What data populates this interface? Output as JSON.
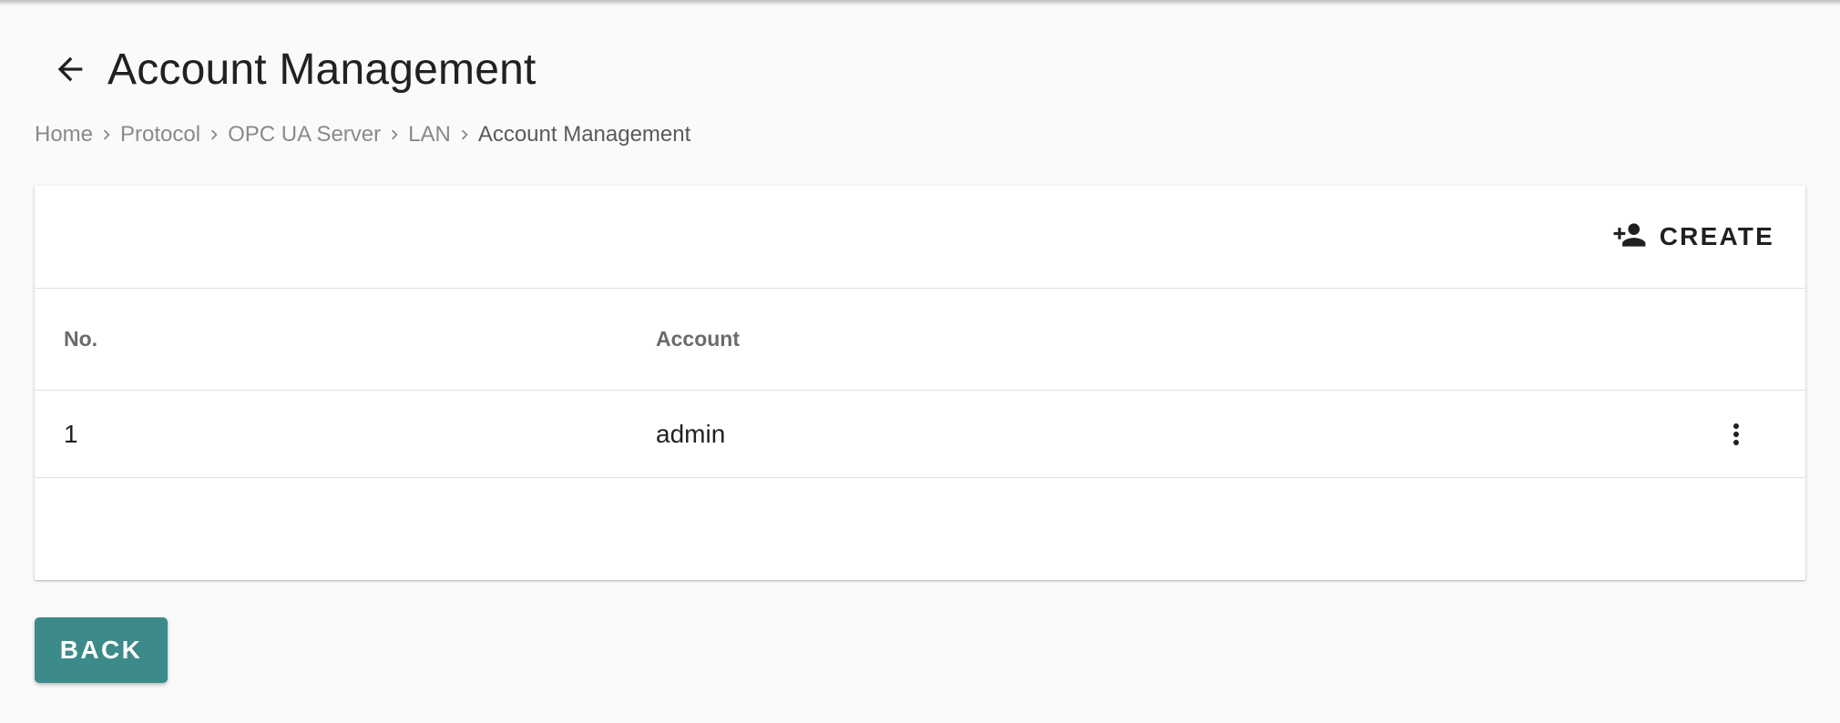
{
  "header": {
    "title": "Account Management",
    "back_icon": "arrow-left-icon"
  },
  "breadcrumb": {
    "items": [
      "Home",
      "Protocol",
      "OPC UA Server",
      "LAN"
    ],
    "current": "Account Management",
    "separator_icon": "chevron-right-icon"
  },
  "toolbar": {
    "create_label": "CREATE",
    "create_icon": "person-add-icon"
  },
  "table": {
    "columns": [
      "No.",
      "Account"
    ],
    "rows": [
      {
        "no": "1",
        "account": "admin",
        "menu_icon": "more-vert-icon"
      }
    ]
  },
  "footer": {
    "back_label": "BACK"
  },
  "colors": {
    "accent": "#3d8a8a",
    "background": "#fafafa",
    "text": "#212121",
    "breadcrumb_text": "#8a8a8a"
  }
}
